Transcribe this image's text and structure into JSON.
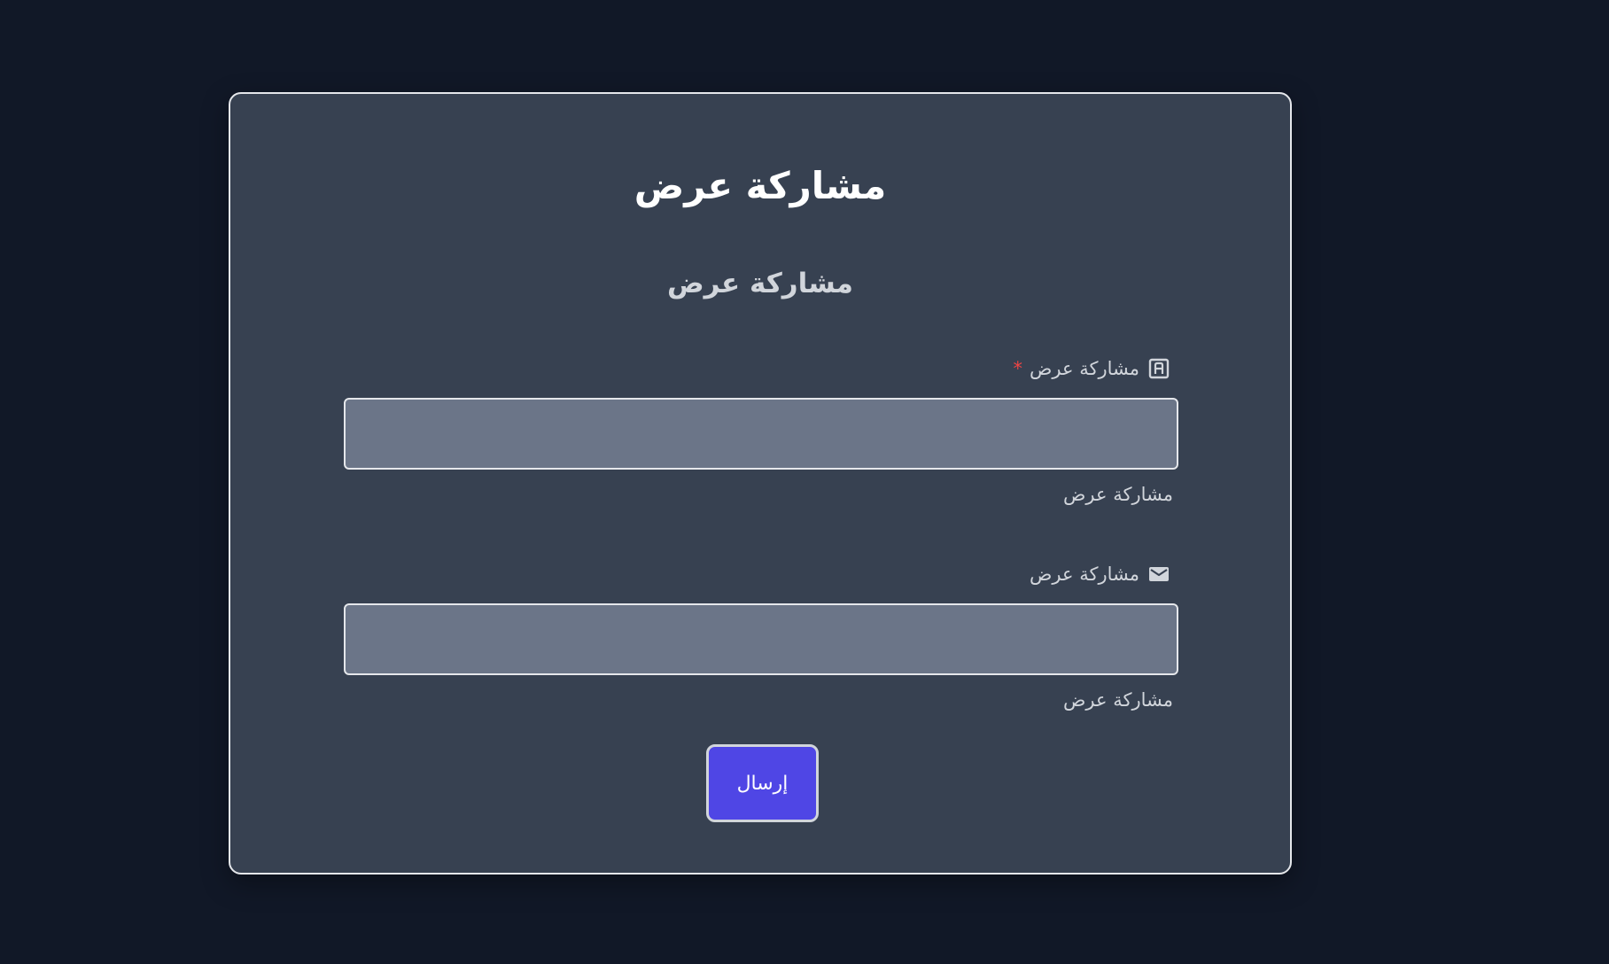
{
  "form": {
    "title": "مشاركة عرض",
    "subtitle": "مشاركة عرض",
    "fields": [
      {
        "label": "مشاركة عرض",
        "icon": "input-box-icon",
        "required": true,
        "required_mark": "*",
        "value": "",
        "help": "مشاركة عرض"
      },
      {
        "label": "مشاركة عرض",
        "icon": "envelope-icon",
        "required": false,
        "value": "",
        "help": "مشاركة عرض"
      }
    ],
    "submit_label": "إرسال"
  },
  "colors": {
    "page_background": "#111827",
    "card_background": "#374151",
    "input_background": "#6b7588",
    "accent": "#4f46e5",
    "required": "#ef4444"
  }
}
